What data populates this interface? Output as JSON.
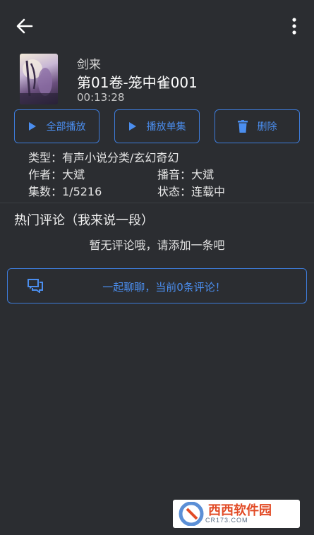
{
  "toolbar": {
    "back_icon": "arrow-left-icon",
    "more_icon": "more-vertical-icon"
  },
  "book": {
    "name": "剑来",
    "chapter": "第01卷-笼中雀001",
    "duration": "00:13:28"
  },
  "actions": {
    "play_all": "全部播放",
    "play_single": "播放单集",
    "delete": "删除"
  },
  "info": {
    "type": "类型：有声小说分类/玄幻奇幻",
    "author": "作者：大斌",
    "narrator": "播音：大斌",
    "episodes": "集数：1/5216",
    "status": "状态：连载中"
  },
  "comments": {
    "title": "热门评论（我来说一段）",
    "empty": "暂无评论哦，请添加一条吧",
    "chat_label": "一起聊聊，当前0条评论！"
  },
  "watermark": {
    "brand": "西西软件园",
    "site": "CR173.COM"
  },
  "colors": {
    "background": "#2b2d31",
    "accent": "#3d7bd9",
    "accent_text": "#4b8eef"
  }
}
